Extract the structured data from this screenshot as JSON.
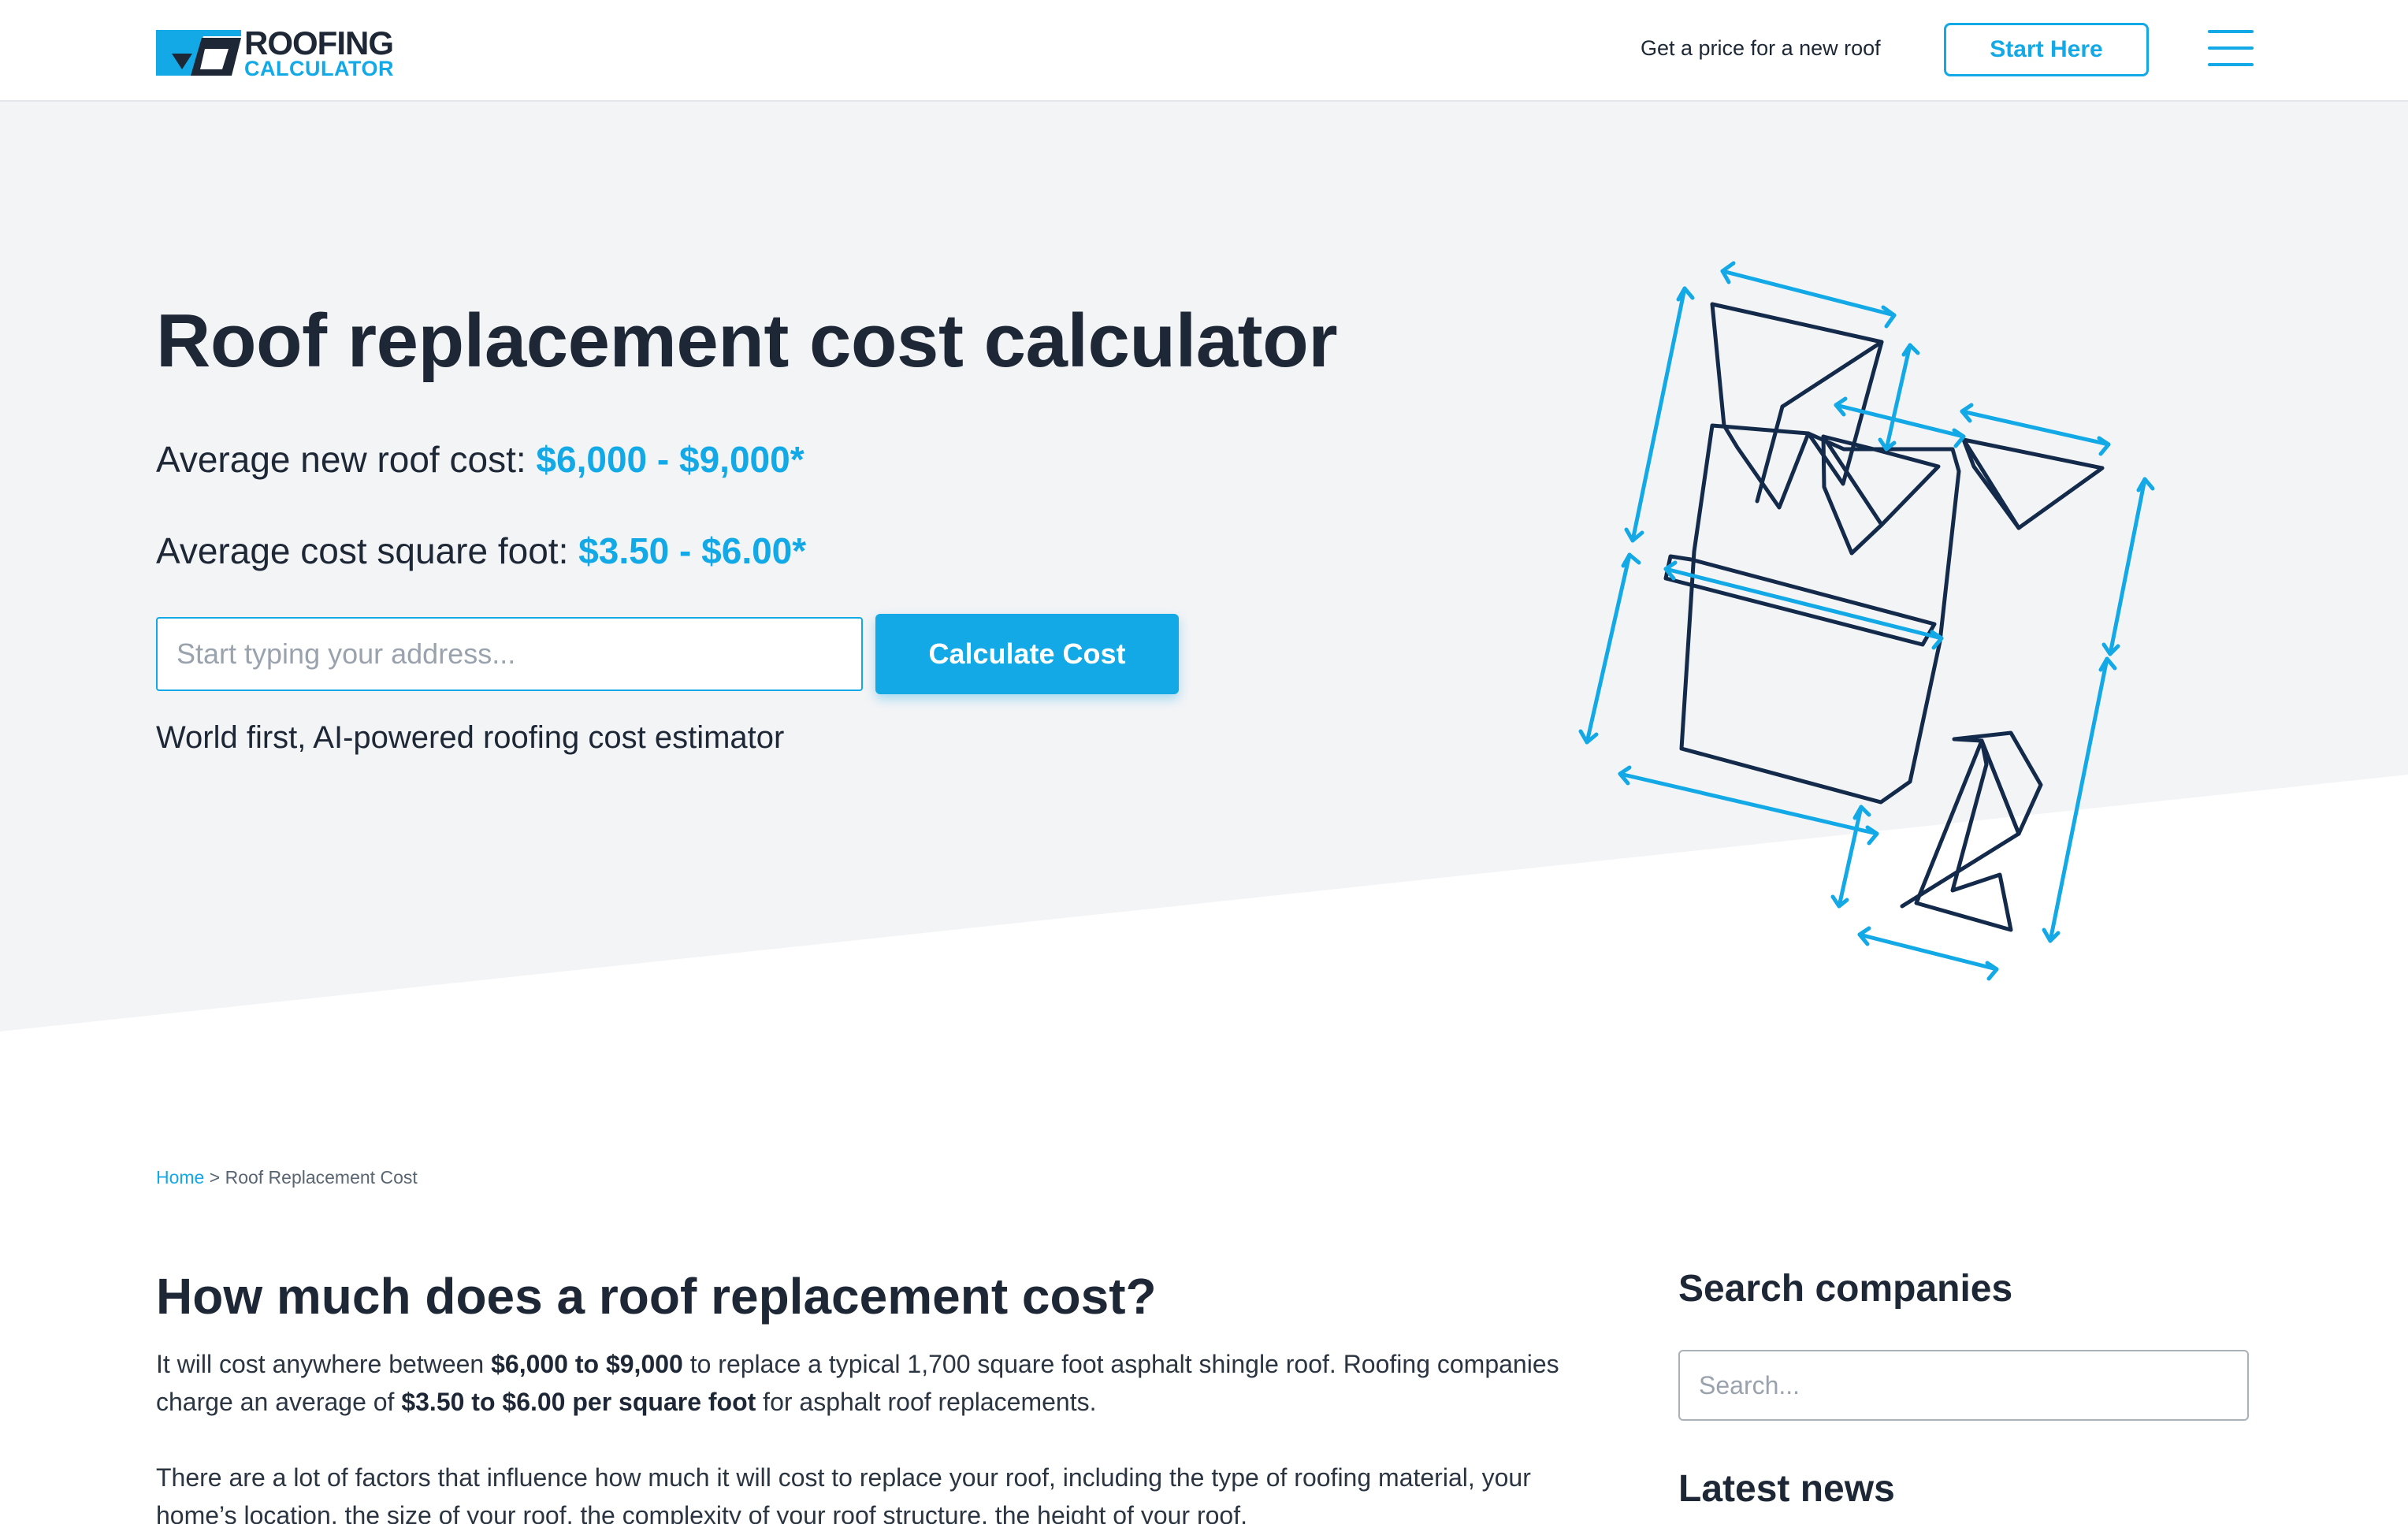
{
  "brand": {
    "line1": "ROOFING",
    "line2": "CALCULATOR",
    "colors": {
      "accent": "#12a9e6",
      "dark": "#1d2735",
      "hero_bg": "#f3f4f6"
    }
  },
  "header": {
    "cta_text": "Get a price for a new roof",
    "start_label": "Start Here",
    "menu_icon": "hamburger-menu-icon"
  },
  "hero": {
    "title": "Roof replacement cost calculator",
    "avg_roof_label": "Average new roof cost: ",
    "avg_roof_value": "$6,000 - $9,000*",
    "avg_sqft_label": "Average cost square foot: ",
    "avg_sqft_value": "$3.50 - $6.00*",
    "address_placeholder": "Start typing your address...",
    "calculate_label": "Calculate Cost",
    "subtitle": "World first, AI-powered roofing cost estimator",
    "illustration": "roof-measurement-icon"
  },
  "breadcrumb": {
    "home": "Home",
    "separator": " > ",
    "current": "Roof Replacement Cost"
  },
  "article": {
    "title": "How much does a roof replacement cost?",
    "p1": {
      "a": "It will cost anywhere between ",
      "b": "$6,000 to $9,000",
      "c": " to replace a typical 1,700 square foot asphalt shingle roof. Roofing companies charge an average of ",
      "d": "$3.50 to $6.00 per square foot",
      "e": " for asphalt roof replacements."
    },
    "p2": "There are a lot of factors that influence how much it will cost to replace your roof, including the type of roofing material, your home’s location, the size of your roof, the complexity of your roof structure, the height of your roof,"
  },
  "sidebar": {
    "search_title": "Search companies",
    "search_placeholder": "Search...",
    "news_title": "Latest news"
  }
}
